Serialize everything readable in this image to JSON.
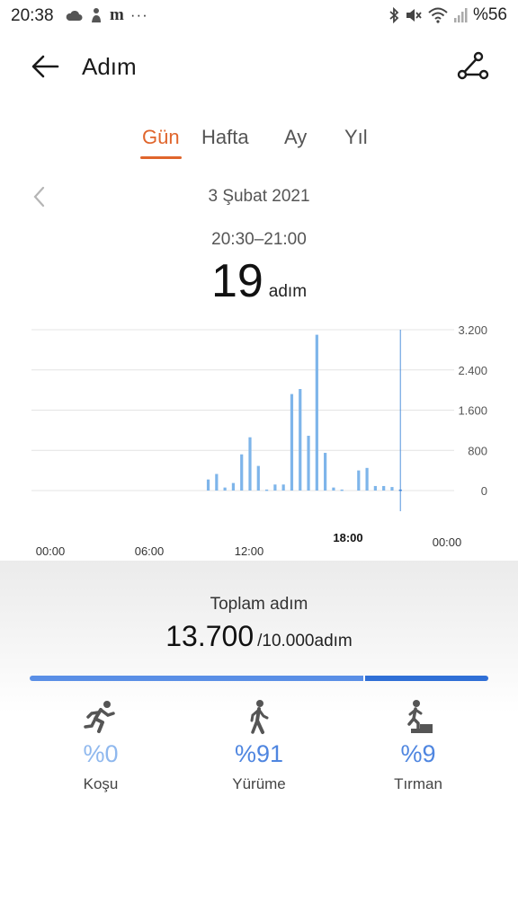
{
  "status_bar": {
    "time": "20:38",
    "notif_letter": "m",
    "more": "···",
    "battery": "%56"
  },
  "header": {
    "title": "Adım"
  },
  "tabs": [
    {
      "label": "Gün",
      "active": true
    },
    {
      "label": "Hafta",
      "active": false
    },
    {
      "label": "Ay",
      "active": false
    },
    {
      "label": "Yıl",
      "active": false
    }
  ],
  "date": "3 Şubat 2021",
  "selection": {
    "range": "20:30–21:00",
    "steps": "19",
    "unit": "adım"
  },
  "chart_data": {
    "type": "bar",
    "x_ticks": [
      "00:00",
      "06:00",
      "12:00",
      "18:00",
      "00:00"
    ],
    "y_ticks": [
      "3.200",
      "2.400",
      "1.600",
      "800",
      "0"
    ],
    "ylim": [
      0,
      3200
    ],
    "bar_color": "#7eb5ea",
    "selected_color": "#3f86d9",
    "grid": true,
    "values": [
      {
        "hour": 9.5,
        "value": 220
      },
      {
        "hour": 10.0,
        "value": 330
      },
      {
        "hour": 10.5,
        "value": 60
      },
      {
        "hour": 11.0,
        "value": 150
      },
      {
        "hour": 11.5,
        "value": 720
      },
      {
        "hour": 12.0,
        "value": 1060
      },
      {
        "hour": 12.5,
        "value": 490
      },
      {
        "hour": 13.0,
        "value": 20
      },
      {
        "hour": 13.5,
        "value": 120
      },
      {
        "hour": 14.0,
        "value": 120
      },
      {
        "hour": 14.5,
        "value": 1920
      },
      {
        "hour": 15.0,
        "value": 2020
      },
      {
        "hour": 15.5,
        "value": 1090
      },
      {
        "hour": 16.0,
        "value": 3100
      },
      {
        "hour": 16.5,
        "value": 750
      },
      {
        "hour": 17.0,
        "value": 60
      },
      {
        "hour": 17.5,
        "value": 20
      },
      {
        "hour": 18.5,
        "value": 400
      },
      {
        "hour": 19.0,
        "value": 450
      },
      {
        "hour": 19.5,
        "value": 90
      },
      {
        "hour": 20.0,
        "value": 90
      },
      {
        "hour": 20.5,
        "value": 70
      },
      {
        "hour": 21.0,
        "value": 19,
        "selected": true
      }
    ],
    "selected_hour": 21.0
  },
  "summary": {
    "label": "Toplam adım",
    "total": "13.700",
    "goal": "/10.000adım",
    "progress_main_color": "#5a8fe6",
    "progress_extra_color": "#2f6fd6"
  },
  "activities": [
    {
      "icon": "running-icon",
      "percent": "%0",
      "label": "Koşu",
      "color": "#8fb8ee"
    },
    {
      "icon": "walking-icon",
      "percent": "%91",
      "label": "Yürüme",
      "color": "#4f86e0"
    },
    {
      "icon": "climbing-icon",
      "percent": "%9",
      "label": "Tırman",
      "color": "#4f86e0"
    }
  ]
}
